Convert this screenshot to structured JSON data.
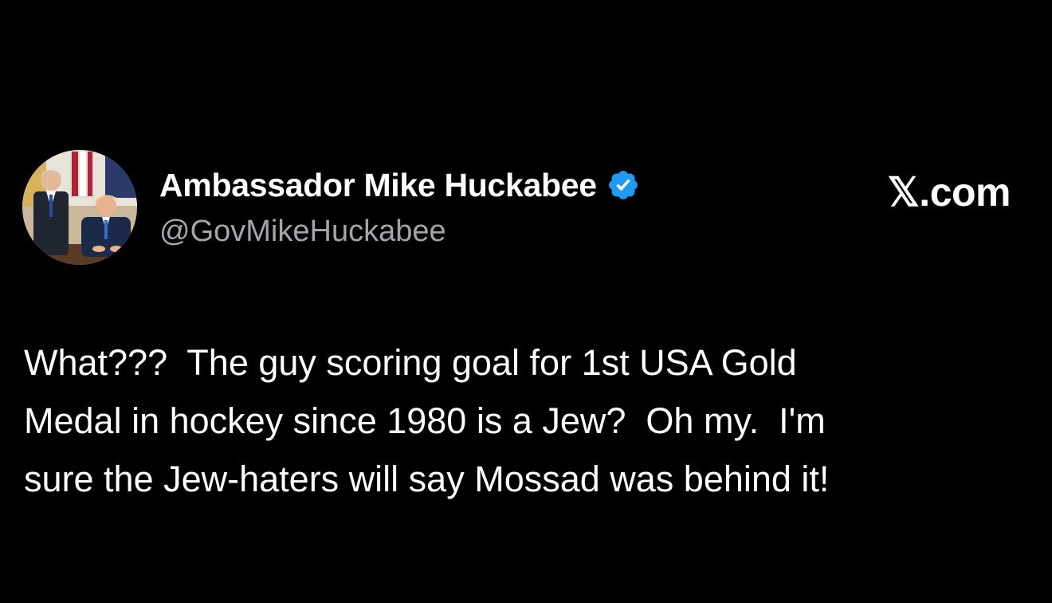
{
  "post": {
    "author": {
      "display_name": "Ambassador Mike Huckabee",
      "handle": "@GovMikeHuckabee",
      "verified": true,
      "verified_badge_color": "#1d9bf0",
      "avatar_icon": "profile-photo"
    },
    "brand": "𝕏.com",
    "text": "What???  The guy scoring goal for 1st USA Gold\nMedal in hockey since 1980 is a Jew?  Oh my.  I'm\nsure the Jew-haters will say Mossad was behind it!"
  },
  "colors": {
    "background": "#000000",
    "text_primary": "#ffffff",
    "text_secondary": "#a2a6ab",
    "accent": "#1d9bf0"
  }
}
